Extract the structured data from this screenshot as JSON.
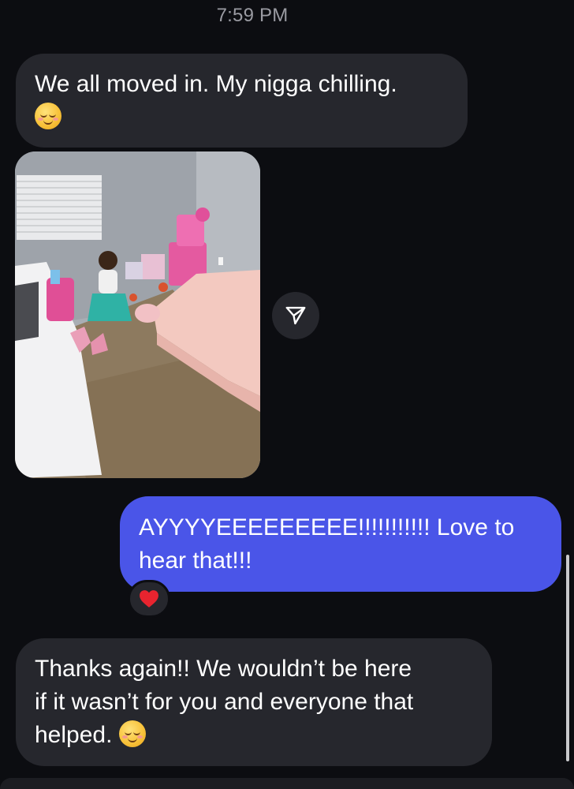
{
  "header": {
    "timestamp": "7:59 PM"
  },
  "messages": [
    {
      "direction": "incoming",
      "type": "text",
      "text": "We all moved in. My nigga chilling.",
      "emoji": "relieved-face"
    },
    {
      "direction": "incoming",
      "type": "photo",
      "photo_description_icon": "photo-of-child-in-bedroom"
    },
    {
      "direction": "outgoing",
      "type": "text",
      "text_line1": "AYYYYEEEEEEEEE!!!!!!!!!!! Love to",
      "text_line2": "hear that!!!",
      "reaction": "red-heart"
    },
    {
      "direction": "incoming",
      "type": "text",
      "text_line1": "Thanks again!! We wouldn’t be here",
      "text_line2": "if it wasn’t for you and everyone that",
      "text_line3": "helped.",
      "emoji": "smiling-face"
    }
  ],
  "colors": {
    "background": "#0c0d11",
    "incoming_bubble": "#26272d",
    "outgoing_bubble": "#4a55e8",
    "text": "#ffffff",
    "timestamp": "#9a9ba2"
  },
  "icons": {
    "forward": "paper-plane-icon",
    "reaction": "heart-icon"
  }
}
